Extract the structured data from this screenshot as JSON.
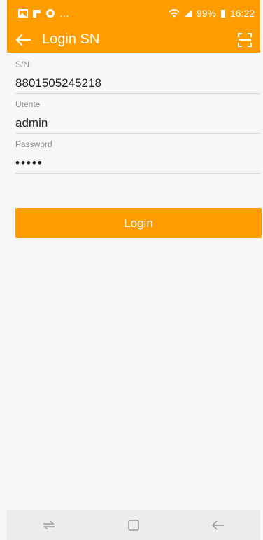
{
  "status_bar": {
    "left_icons": [
      "image-icon",
      "flipboard-icon",
      "whatsapp-icon",
      "more-dots-icon"
    ],
    "battery": "99%",
    "time": "16:22"
  },
  "app_bar": {
    "title": "Login SN"
  },
  "form": {
    "sn": {
      "label": "S/N",
      "value": "8801505245218"
    },
    "user": {
      "label": "Utente",
      "value": "admin"
    },
    "password": {
      "label": "Password",
      "value": "•••••"
    }
  },
  "buttons": {
    "login": "Login"
  },
  "colors": {
    "accent": "#ff9c00",
    "background": "#f7f7f7"
  },
  "nav_bar": {
    "icons": [
      "recent-apps-icon",
      "home-icon",
      "back-icon"
    ]
  }
}
